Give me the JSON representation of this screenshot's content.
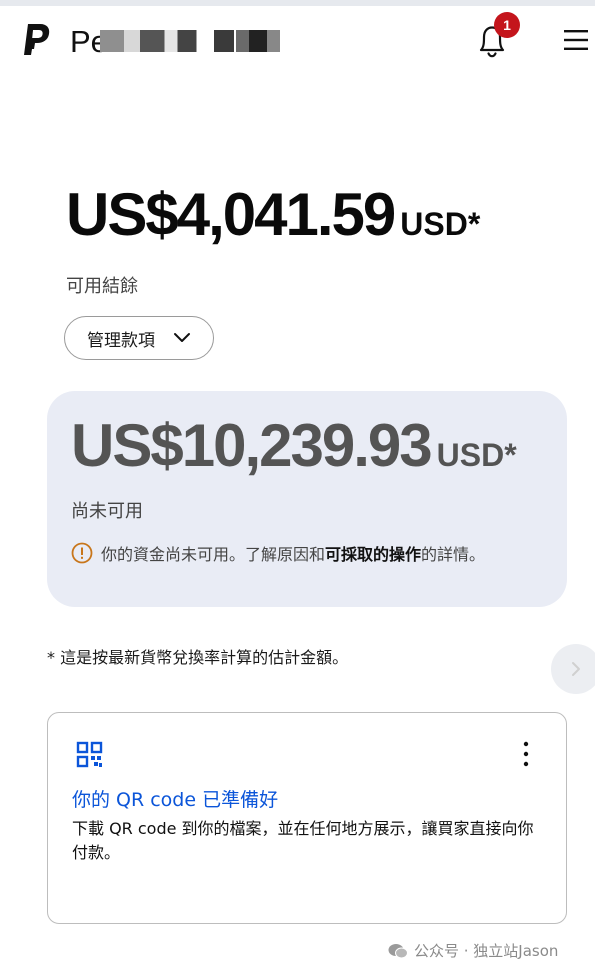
{
  "header": {
    "brand_name": "Pe            in",
    "notification_count": "1"
  },
  "balance": {
    "available_amount": "US$4,041.59",
    "available_currency": "USD*",
    "available_label": "可用結餘",
    "manage_button_label": "管理款項"
  },
  "pending": {
    "amount": "US$10,239.93",
    "currency": "USD*",
    "label": "尚未可用",
    "notice_prefix": "你的資金尚未可用。了解原因和",
    "notice_link": "可採取的操作",
    "notice_suffix": "的詳情。"
  },
  "footnote": "* 這是按最新貨幣兌換率計算的估計金額。",
  "qr_card": {
    "title": "你的 QR code 已準備好",
    "description": "下載 QR code 到你的檔案，並在任何地方展示，讓買家直接向你付款。"
  },
  "watermark": "公众号 · 独立站Jason",
  "colors": {
    "brand_dark": "#111111",
    "badge_red": "#c4151c",
    "link_blue": "#0b55d9",
    "card_bg": "#e9ecf5",
    "warning_orange": "#c8761b"
  }
}
